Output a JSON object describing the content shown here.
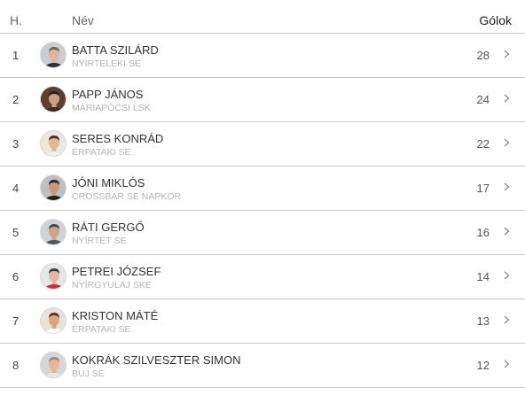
{
  "header": {
    "rank_label": "H.",
    "name_label": "Név",
    "goals_label": "Gólok"
  },
  "rows": [
    {
      "rank": "1",
      "name": "BATTA SZILÁRD",
      "team": "NYÍRTELEKI SE",
      "goals": "28",
      "avatar": {
        "bg": "#c9cdd2",
        "skin": "#d9b7a0",
        "hair": "#6a6560",
        "shirt": "#2c2f36"
      }
    },
    {
      "rank": "2",
      "name": "PAPP JÁNOS",
      "team": "MÁRIAPÓCSI LSK",
      "goals": "24",
      "avatar": {
        "bg": "#5a4030",
        "skin": "#caa08a",
        "hair": "#2a1d16",
        "shirt": "#3a2a20"
      }
    },
    {
      "rank": "3",
      "name": "SERES KONRÁD",
      "team": "ÉRPATAKI SE",
      "goals": "22",
      "avatar": {
        "bg": "#ece7df",
        "skin": "#e0b89b",
        "hair": "#4b3426",
        "shirt": "#f0f0f0"
      }
    },
    {
      "rank": "4",
      "name": "JÓNI MIKLÓS",
      "team": "CROSSBAR SE NAPKOR",
      "goals": "17",
      "avatar": {
        "bg": "#bfbfbf",
        "skin": "#c59a80",
        "hair": "#2b2522",
        "shirt": "#1e1e1e"
      }
    },
    {
      "rank": "5",
      "name": "RÁTI GERGŐ",
      "team": "NYÍRTÉT SE",
      "goals": "16",
      "avatar": {
        "bg": "#cfd3d8",
        "skin": "#c9a48e",
        "hair": "#4a4744",
        "shirt": "#4e545c"
      }
    },
    {
      "rank": "6",
      "name": "PETREI JÓZSEF",
      "team": "NYÍRGYULAJ SKE",
      "goals": "14",
      "avatar": {
        "bg": "#e6e6e6",
        "skin": "#e2b9a2",
        "hair": "#3d3d3d",
        "shirt": "#c9323a"
      }
    },
    {
      "rank": "7",
      "name": "KRISTON MÁTÉ",
      "team": "ÉRPATAKI SE",
      "goals": "13",
      "avatar": {
        "bg": "#e9e2da",
        "skin": "#d9a585",
        "hair": "#5b3a26",
        "shirt": "#ffffff"
      }
    },
    {
      "rank": "8",
      "name": "KOKRÁK SZILVESZTER SIMON",
      "team": "BUJ SE",
      "goals": "12",
      "avatar": {
        "bg": "#d6d6d6",
        "skin": "#e3b897",
        "hair": "#9a8a78",
        "shirt": "#e8e8e8"
      }
    }
  ]
}
